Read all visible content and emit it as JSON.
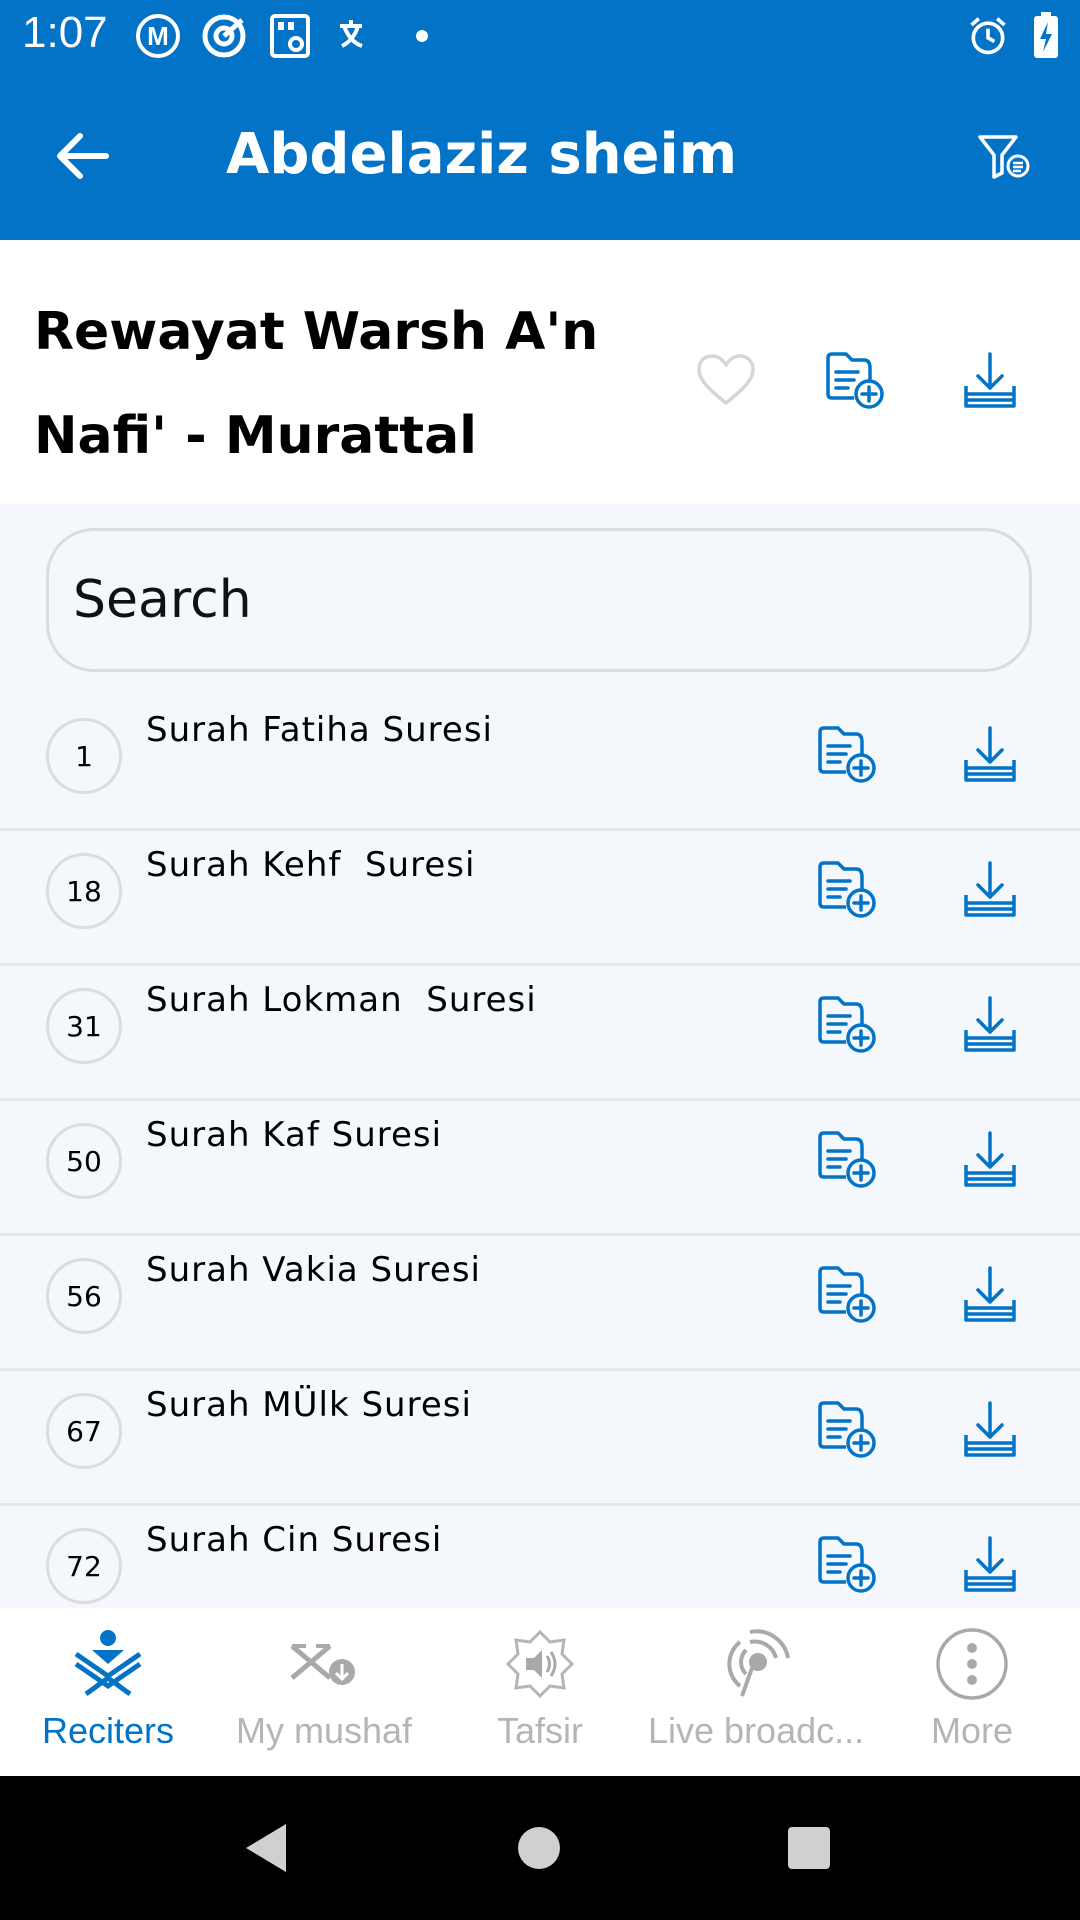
{
  "status_bar": {
    "time": "1:07",
    "left_icons": [
      "m-badge-icon",
      "target-icon",
      "sim-storage-icon",
      "translate-icon",
      "dot-icon"
    ],
    "right_icons": [
      "alarm-icon",
      "battery-charging-icon"
    ]
  },
  "app_bar": {
    "title": "Abdelaziz sheim",
    "back_icon": "arrow-left-icon",
    "filter_icon": "filter-list-icon"
  },
  "collection": {
    "title": "Rewayat Warsh A'n Nafi' - Murattal",
    "favorite_icon": "heart-outline-icon",
    "add_to_playlist_icon": "folder-add-icon",
    "download_icon": "download-icon"
  },
  "search": {
    "placeholder": "Search"
  },
  "surahs": [
    {
      "number": "1",
      "name": "Surah Fatiha Suresi"
    },
    {
      "number": "18",
      "name": "Surah Kehf  Suresi"
    },
    {
      "number": "31",
      "name": "Surah Lokman  Suresi"
    },
    {
      "number": "50",
      "name": "Surah Kaf Suresi"
    },
    {
      "number": "56",
      "name": "Surah Vakia Suresi"
    },
    {
      "number": "67",
      "name": "Surah MÜlk Suresi"
    },
    {
      "number": "72",
      "name": "Surah Cin Suresi"
    }
  ],
  "bottom_nav": [
    {
      "label": "Reciters",
      "icon": "reciter-icon",
      "active": true
    },
    {
      "label": "My mushaf",
      "icon": "mushaf-icon",
      "active": false
    },
    {
      "label": "Tafsir",
      "icon": "tafsir-speaker-icon",
      "active": false
    },
    {
      "label": "Live broadc...",
      "icon": "broadcast-icon",
      "active": false
    },
    {
      "label": "More",
      "icon": "more-dots-icon",
      "active": false
    }
  ],
  "colors": {
    "primary": "#0273c6",
    "list_background": "#f4f8fc",
    "inactive": "#b5b5b5",
    "divider": "#e3e8ee"
  }
}
